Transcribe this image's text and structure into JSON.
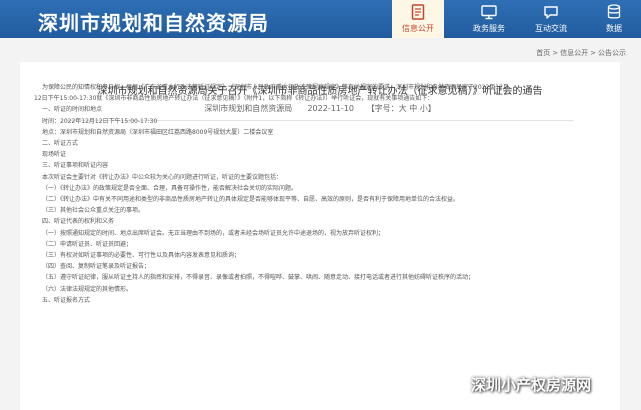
{
  "header": {
    "site_title": "深圳市规划和自然资源局",
    "nav": [
      {
        "label": "信息公开",
        "icon": "document-icon",
        "active": true
      },
      {
        "label": "政务服务",
        "icon": "monitor-icon",
        "active": false
      },
      {
        "label": "互动交流",
        "icon": "chat-icon",
        "active": false
      },
      {
        "label": "数据",
        "icon": "database-icon",
        "active": false
      }
    ]
  },
  "breadcrumb": [
    "首页",
    "信息公开",
    "公告公示"
  ],
  "article": {
    "title": "深圳市规划和自然资源局关于召开《深圳市非商品性质房地产转让办法（征求意见稿）》听证会的通告",
    "source": "深圳市规划和自然资源局",
    "date": "2022-11-10",
    "font_size_label": "【字号：",
    "font_large": "大",
    "font_medium": "中",
    "font_small": "小",
    "font_size_end": "】",
    "paragraphs": [
      "为保障公民的知情权和参与权，根据《广东省重大行政决策听证规定》、《深圳市人民政府重大行政决策程序规定》等有关规定的要求，深圳市规划和自然资源局定于2022年12月",
      "12日下午15:00-17:30就《深圳市非商品性质房地产转让办法（征求意见稿）》（附件1，以下简称《转让办法》）举行听证会，现就有关事项通告如下：",
      "一、听证的时间和地点",
      "时间：2022年12月12日下午15:00-17:30",
      "地点：深圳市规划和自然资源局（深圳市福田区红荔西路8009号规划大厦）二楼会议室",
      "二、听证方式",
      "现场听证",
      "三、听证事项和听证内容",
      "本次听证会主要针对《转让办法》中公众较为关心的问题进行听证，听证的主要议题包括：",
      "（一）《转让办法》的政策规定是否全面、合理，具备可操作性，能否解决社会关切的实际问题。",
      "（二）《转让办法》中有关不同用途和类型的非商品性质房地产转让的具体规定是否能够体现平等、自愿、高效的原则，是否有利于保障用地单位的合法权益。",
      "（三）其他社会公众重点关注的事项。",
      "四、听证代表的权利和义务",
      "（一）按照通知规定的时间、地点出席听证会。无正当理由不到场的，或者未经会场听证员允许中途退场的，视为放弃听证权利；",
      "（二）申请听证员、听证员回避；",
      "（三）有权对如听证事项的必要性、可行性以及具体内容发表意见和质询；",
      "（四）查阅、复制听证笔录及听证报告；",
      "（五）遵守听证纪律，服从听证主持人的指挥和安排，不得录音、录像或者拍照，不得喧哗、鼓掌、哄闹、随意走动、接打电话或者进行其他妨碍听证秩序的活动；",
      "（六）法律法规规定的其他情形。",
      "五、听证报名方式"
    ]
  },
  "watermark": {
    "text": "深圳小产权房源网",
    "icon": "wechat-icon"
  }
}
